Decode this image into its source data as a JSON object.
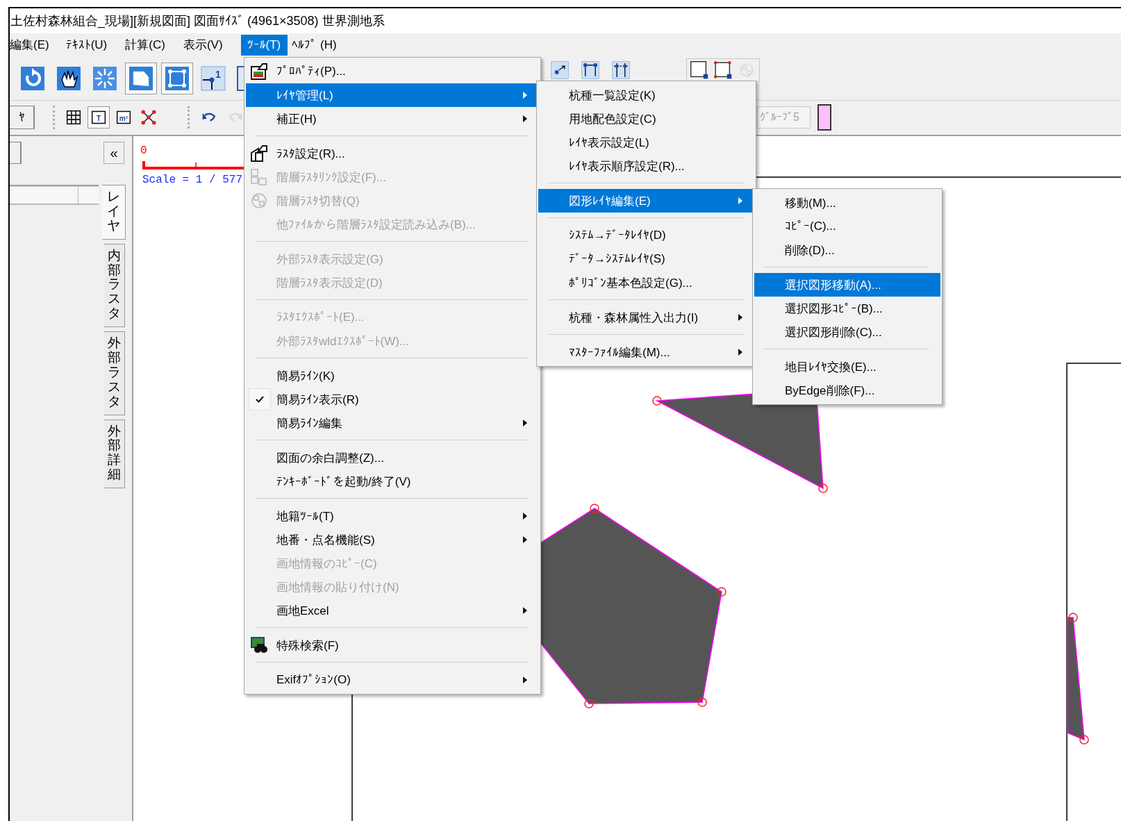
{
  "window": {
    "title": "土佐村森林組合_現場][新規図面] 図面ｻｲｽﾞ (4961×3508) 世界測地系"
  },
  "menubar": [
    {
      "label": "編集(E)",
      "selected": false
    },
    {
      "label": "ﾃｷｽﾄ(U)",
      "selected": false
    },
    {
      "label": "計算(C)",
      "selected": false
    },
    {
      "label": "表示(V)",
      "selected": false
    },
    {
      "label": "ﾂｰﾙ(T)",
      "selected": true
    },
    {
      "label": "ﾍﾙﾌﾟ (H)",
      "selected": false
    }
  ],
  "toolbar": {
    "row_1": [
      {
        "buttons": [
          {
            "kind": "rotate",
            "pressed": false,
            "disabled": false
          },
          {
            "kind": "hand",
            "pressed": false,
            "disabled": false
          },
          {
            "kind": "burst",
            "pressed": false,
            "disabled": false
          },
          {
            "kind": "shape-frame",
            "pressed": true,
            "disabled": false
          },
          {
            "kind": "square-nodes",
            "pressed": true,
            "disabled": false
          },
          {
            "kind": "node-number",
            "label": "1",
            "pressed": false,
            "disabled": false
          },
          {
            "kind": "panel",
            "pressed": false,
            "disabled": false
          }
        ]
      },
      {
        "buttons": [
          {
            "kind": "node-arrow",
            "pressed": false,
            "disabled": false
          },
          {
            "kind": "node-link",
            "pressed": false,
            "disabled": false
          },
          {
            "kind": "node-dots",
            "pressed": false,
            "disabled": false
          }
        ]
      },
      {
        "buttons": [
          {
            "kind": "frame-corner",
            "pressed": false,
            "disabled": false
          },
          {
            "kind": "red-corners",
            "pressed": false,
            "disabled": false
          },
          {
            "kind": "raster-switch",
            "pressed": false,
            "disabled": true
          }
        ]
      }
    ],
    "row_2": {
      "layer_button": "ﾔ",
      "tools": [
        {
          "kind": "grid",
          "pressed": false,
          "disabled": false
        },
        {
          "kind": "text-frame",
          "label": "T",
          "pressed": true,
          "disabled": false
        },
        {
          "kind": "area-frame",
          "label": "m²",
          "pressed": false,
          "disabled": false
        },
        {
          "kind": "red-nodes",
          "pressed": false,
          "disabled": false
        }
      ],
      "edit": [
        {
          "kind": "undo",
          "pressed": false,
          "disabled": false
        },
        {
          "kind": "redo",
          "pressed": false,
          "disabled": true
        }
      ],
      "group_field": {
        "value": "ｸﾞﾙｰﾌﾟ5",
        "disabled": true
      },
      "swatch": {
        "color": "#ffc0ff"
      }
    }
  },
  "side_panel": {
    "collapse_button": "«",
    "tabs": [
      {
        "label": "レイヤ",
        "selected": true
      },
      {
        "label": "内部ラスタ",
        "selected": false
      },
      {
        "label": "外部ラスタ",
        "selected": false
      },
      {
        "label": "外部詳細",
        "selected": false
      }
    ]
  },
  "canvas": {
    "scale_origin": "0",
    "scale_text": "Scale = 1 / 577"
  },
  "menu": {
    "items": [
      {
        "kind": "item",
        "label": "ﾌﾟﾛﾊﾟﾃｨ(P)...",
        "selected": false,
        "disabled": false,
        "checked": false,
        "has_submenu": false
      },
      {
        "kind": "item",
        "label": "ﾚｲﾔ管理(L)",
        "selected": true,
        "disabled": false,
        "checked": false,
        "has_submenu": true,
        "submenu": [
          {
            "kind": "item",
            "label": "杭種一覧設定(K)",
            "selected": false,
            "disabled": false,
            "has_submenu": false
          },
          {
            "kind": "item",
            "label": "用地配色設定(C)",
            "selected": false,
            "disabled": false,
            "has_submenu": false
          },
          {
            "kind": "item",
            "label": "ﾚｲﾔ表示設定(L)",
            "selected": false,
            "disabled": false,
            "has_submenu": false
          },
          {
            "kind": "item",
            "label": "ﾚｲﾔ表示順序設定(R)...",
            "selected": false,
            "disabled": false,
            "has_submenu": false
          },
          {
            "kind": "separator"
          },
          {
            "kind": "item",
            "label": "図形ﾚｲﾔ編集(E)",
            "selected": true,
            "disabled": false,
            "has_submenu": true,
            "submenu": [
              {
                "kind": "item",
                "label": "移動(M)...",
                "selected": false,
                "disabled": false,
                "has_submenu": false
              },
              {
                "kind": "item",
                "label": "ｺﾋﾟｰ(C)...",
                "selected": false,
                "disabled": false,
                "has_submenu": false
              },
              {
                "kind": "item",
                "label": "削除(D)...",
                "selected": false,
                "disabled": false,
                "has_submenu": false
              },
              {
                "kind": "separator"
              },
              {
                "kind": "item",
                "label": "選択図形移動(A)...",
                "selected": true,
                "disabled": false,
                "has_submenu": false
              },
              {
                "kind": "item",
                "label": "選択図形ｺﾋﾟｰ(B)...",
                "selected": false,
                "disabled": false,
                "has_submenu": false
              },
              {
                "kind": "item",
                "label": "選択図形削除(C)...",
                "selected": false,
                "disabled": false,
                "has_submenu": false
              },
              {
                "kind": "separator"
              },
              {
                "kind": "item",
                "label": "地目ﾚｲﾔ交換(E)...",
                "selected": false,
                "disabled": false,
                "has_submenu": false
              },
              {
                "kind": "item",
                "label": "ByEdge削除(F)...",
                "selected": false,
                "disabled": false,
                "has_submenu": false
              }
            ]
          },
          {
            "kind": "separator"
          },
          {
            "kind": "item",
            "label": "ｼｽﾃﾑ→ﾃﾞｰﾀﾚｲﾔ(D)",
            "selected": false,
            "disabled": false,
            "has_submenu": false
          },
          {
            "kind": "item",
            "label": "ﾃﾞｰﾀ→ｼｽﾃﾑﾚｲﾔ(S)",
            "selected": false,
            "disabled": false,
            "has_submenu": false
          },
          {
            "kind": "item",
            "label": "ﾎﾟﾘｺﾞﾝ基本色設定(G)...",
            "selected": false,
            "disabled": false,
            "has_submenu": false
          },
          {
            "kind": "separator"
          },
          {
            "kind": "item",
            "label": "杭種・森林属性入出力(I)",
            "selected": false,
            "disabled": false,
            "has_submenu": true
          },
          {
            "kind": "separator"
          },
          {
            "kind": "item",
            "label": "ﾏｽﾀｰﾌｧｲﾙ編集(M)...",
            "selected": false,
            "disabled": false,
            "has_submenu": true
          }
        ]
      },
      {
        "kind": "item",
        "label": "補正(H)",
        "selected": false,
        "disabled": false,
        "checked": false,
        "has_submenu": true
      },
      {
        "kind": "separator"
      },
      {
        "kind": "item",
        "label": "ﾗｽﾀ設定(R)...",
        "selected": false,
        "disabled": false,
        "checked": false,
        "has_submenu": false
      },
      {
        "kind": "item",
        "label": "階層ﾗｽﾀﾘﾝｸ設定(F)...",
        "selected": false,
        "disabled": true,
        "checked": false,
        "has_submenu": false
      },
      {
        "kind": "item",
        "label": "階層ﾗｽﾀ切替(Q)",
        "selected": false,
        "disabled": true,
        "checked": false,
        "has_submenu": false
      },
      {
        "kind": "item",
        "label": "他ﾌｧｲﾙから階層ﾗｽﾀ設定読み込み(B)...",
        "selected": false,
        "disabled": true,
        "checked": false,
        "has_submenu": false
      },
      {
        "kind": "separator"
      },
      {
        "kind": "item",
        "label": "外部ﾗｽﾀ表示設定(G)",
        "selected": false,
        "disabled": true,
        "checked": false,
        "has_submenu": false
      },
      {
        "kind": "item",
        "label": "階層ﾗｽﾀ表示設定(D)",
        "selected": false,
        "disabled": true,
        "checked": false,
        "has_submenu": false
      },
      {
        "kind": "separator"
      },
      {
        "kind": "item",
        "label": "ﾗｽﾀｴｸｽﾎﾟｰﾄ(E)...",
        "selected": false,
        "disabled": true,
        "checked": false,
        "has_submenu": false
      },
      {
        "kind": "item",
        "label": "外部ﾗｽﾀwldｴｸｽﾎﾟｰﾄ(W)...",
        "selected": false,
        "disabled": true,
        "checked": false,
        "has_submenu": false
      },
      {
        "kind": "separator"
      },
      {
        "kind": "item",
        "label": "簡易ﾗｲﾝ(K)",
        "selected": false,
        "disabled": false,
        "checked": false,
        "has_submenu": false
      },
      {
        "kind": "item",
        "label": "簡易ﾗｲﾝ表示(R)",
        "selected": false,
        "disabled": false,
        "checked": true,
        "has_submenu": false
      },
      {
        "kind": "item",
        "label": "簡易ﾗｲﾝ編集",
        "selected": false,
        "disabled": false,
        "checked": false,
        "has_submenu": true
      },
      {
        "kind": "separator"
      },
      {
        "kind": "item",
        "label": "図面の余白調整(Z)...",
        "selected": false,
        "disabled": false,
        "checked": false,
        "has_submenu": false
      },
      {
        "kind": "item",
        "label": "ﾃﾝｷｰﾎﾞｰﾄﾞを起動/終了(V)",
        "selected": false,
        "disabled": false,
        "checked": false,
        "has_submenu": false
      },
      {
        "kind": "separator"
      },
      {
        "kind": "item",
        "label": "地籍ﾂｰﾙ(T)",
        "selected": false,
        "disabled": false,
        "checked": false,
        "has_submenu": true
      },
      {
        "kind": "item",
        "label": "地番・点名機能(S)",
        "selected": false,
        "disabled": false,
        "checked": false,
        "has_submenu": true
      },
      {
        "kind": "item",
        "label": "画地情報のｺﾋﾟｰ(C)",
        "selected": false,
        "disabled": true,
        "checked": false,
        "has_submenu": false
      },
      {
        "kind": "item",
        "label": "画地情報の貼り付け(N)",
        "selected": false,
        "disabled": true,
        "checked": false,
        "has_submenu": false
      },
      {
        "kind": "item",
        "label": "画地Excel",
        "selected": false,
        "disabled": false,
        "checked": false,
        "has_submenu": true
      },
      {
        "kind": "separator"
      },
      {
        "kind": "item",
        "label": "特殊検索(F)",
        "selected": false,
        "disabled": false,
        "checked": false,
        "has_submenu": false
      },
      {
        "kind": "separator"
      },
      {
        "kind": "item",
        "label": "Exifｵﾌﾟｼｮﾝ(O)",
        "selected": false,
        "disabled": false,
        "checked": false,
        "has_submenu": true
      }
    ]
  }
}
